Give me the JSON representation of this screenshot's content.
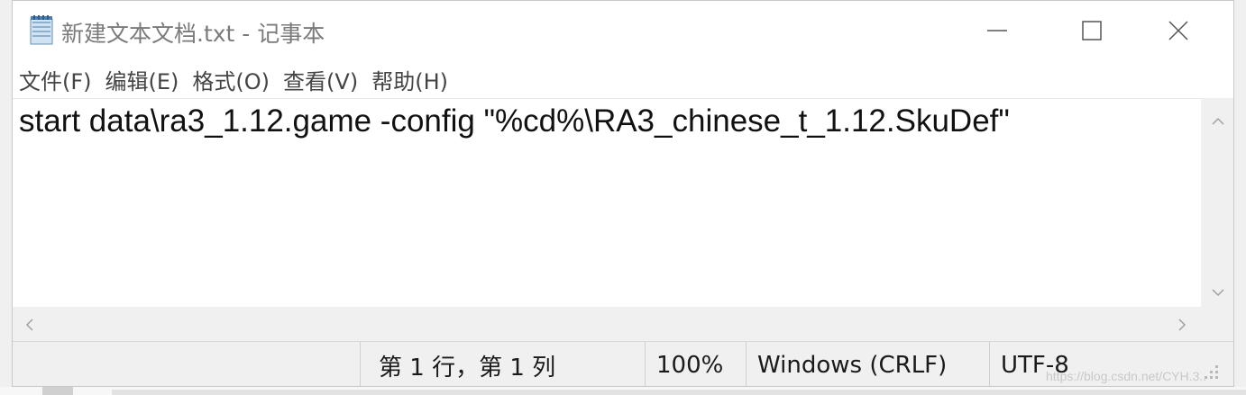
{
  "window": {
    "title": "新建文本文档.txt - 记事本",
    "icon": "notepad-icon"
  },
  "controls": {
    "minimize_icon": "minimize-icon",
    "maximize_icon": "maximize-icon",
    "close_icon": "close-icon"
  },
  "menu": [
    {
      "label": "文件(F)"
    },
    {
      "label": "编辑(E)"
    },
    {
      "label": "格式(O)"
    },
    {
      "label": "查看(V)"
    },
    {
      "label": "帮助(H)"
    }
  ],
  "editor": {
    "content": "start data\\ra3_1.12.game -config \"%cd%\\RA3_chinese_t_1.12.SkuDef\""
  },
  "statusbar": {
    "position": "第 1 行，第 1 列",
    "zoom": "100%",
    "line_ending": "Windows (CRLF)",
    "encoding": "UTF-8"
  },
  "watermark": "https://blog.csdn.net/CYH.3.."
}
